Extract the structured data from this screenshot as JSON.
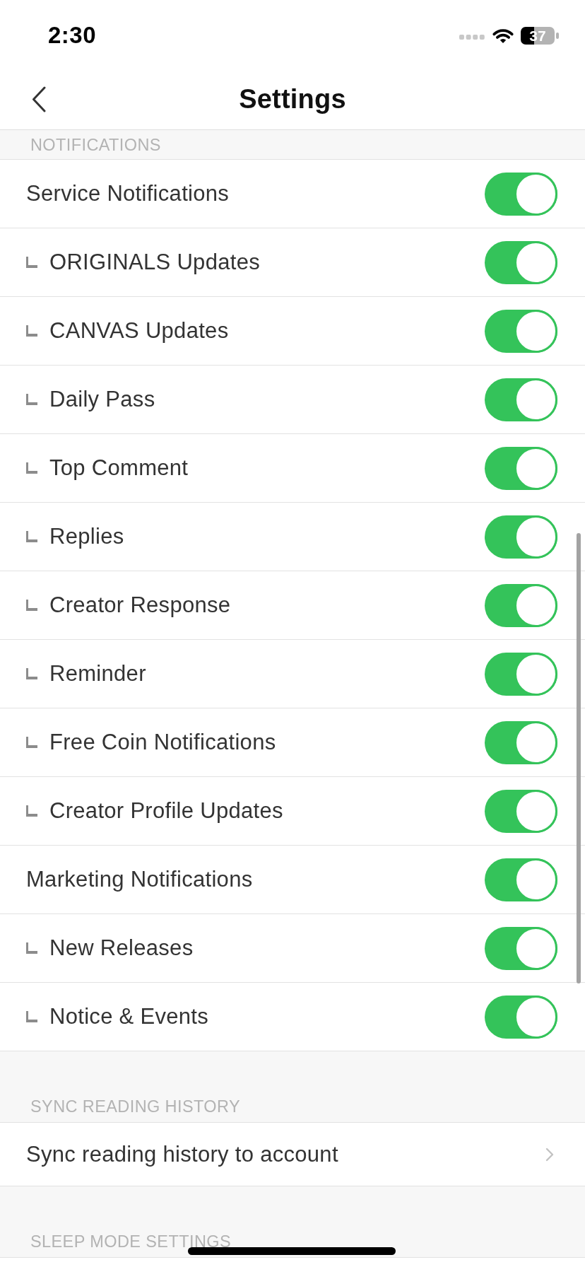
{
  "status_bar": {
    "time": "2:30",
    "battery": "37"
  },
  "header": {
    "title": "Settings"
  },
  "sections": [
    {
      "title": "NOTIFICATIONS",
      "items": [
        {
          "kind": "toggle",
          "label": "Service Notifications",
          "on": true,
          "children": [
            {
              "kind": "toggle",
              "label": "ORIGINALS Updates",
              "on": true
            },
            {
              "kind": "toggle",
              "label": "CANVAS Updates",
              "on": true
            },
            {
              "kind": "toggle",
              "label": "Daily Pass",
              "on": true
            },
            {
              "kind": "toggle",
              "label": "Top Comment",
              "on": true
            },
            {
              "kind": "toggle",
              "label": "Replies",
              "on": true
            },
            {
              "kind": "toggle",
              "label": "Creator Response",
              "on": true
            },
            {
              "kind": "toggle",
              "label": "Reminder",
              "on": true
            },
            {
              "kind": "toggle",
              "label": "Free Coin Notifications",
              "on": true
            },
            {
              "kind": "toggle",
              "label": "Creator Profile Updates",
              "on": true
            }
          ]
        },
        {
          "kind": "toggle",
          "label": "Marketing Notifications",
          "on": true,
          "children": [
            {
              "kind": "toggle",
              "label": "New Releases",
              "on": true
            },
            {
              "kind": "toggle",
              "label": "Notice & Events",
              "on": true
            }
          ]
        }
      ]
    },
    {
      "title": "SYNC READING HISTORY",
      "items": [
        {
          "kind": "link",
          "label": "Sync reading history to account"
        }
      ]
    },
    {
      "title": "SLEEP MODE SETTINGS"
    }
  ]
}
